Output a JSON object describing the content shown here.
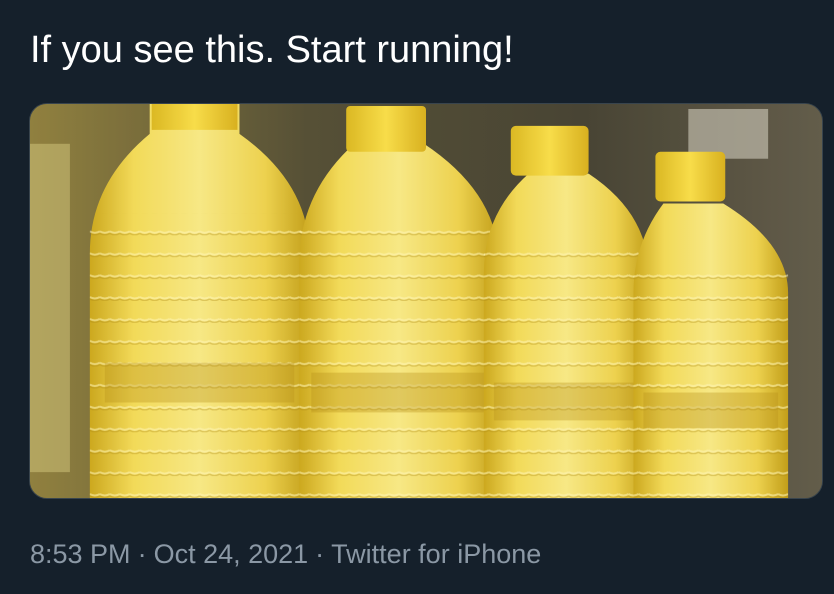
{
  "tweet": {
    "text": "If you see this. Start running!",
    "media_alt": "Four plastic bottles of yellow cooking oil with yellow caps on a store shelf",
    "time": "8:53 PM",
    "separator": "·",
    "date": "Oct 24, 2021",
    "source": "Twitter for iPhone"
  },
  "colors": {
    "background": "#15202b",
    "text": "#ffffff",
    "meta_text": "#8b98a5",
    "media_border": "#38444d",
    "oil_yellow": "#e9c93a",
    "cap_yellow": "#f3d437"
  }
}
